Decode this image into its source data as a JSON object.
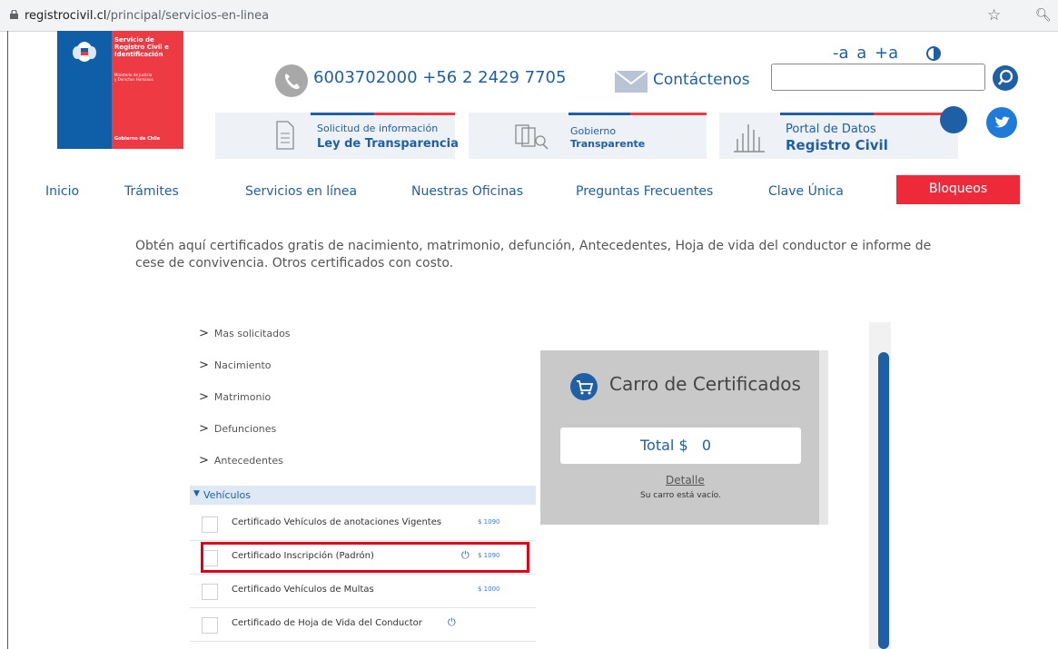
{
  "browser": {
    "url_host": "registrocivil.cl",
    "url_path": "/principal/servicios-en-linea"
  },
  "logo": {
    "line1": "Servicio de",
    "line2": "Registro Civil e",
    "line3": "Identificación",
    "sub1": "Ministerio de Justicia",
    "sub2": "y Derechos Humanos",
    "bottom": "Gobierno de Chile"
  },
  "header": {
    "phone": "6003702000 +56 2 2429 7705",
    "contact": "Contáctenos",
    "font_small": "-a",
    "font_normal": "a",
    "font_large": "+a",
    "search_value": ""
  },
  "info_boxes": [
    {
      "small": "Solicitud de información",
      "big": "Ley de Transparencia"
    },
    {
      "small": "Gobierno",
      "big": "Transparente"
    },
    {
      "small": "Portal de Datos",
      "big": "Registro Civil"
    }
  ],
  "nav": {
    "items": [
      "Inicio",
      "Trámites",
      "Servicios en línea",
      "Nuestras Oficinas",
      "Preguntas Frecuentes",
      "Clave Única"
    ],
    "highlight": "Bloqueos"
  },
  "intro": "Obtén aquí certificados gratis de nacimiento, matrimonio, defunción, Antecedentes, Hoja de vida del conductor e informe de cese de convivencia. Otros certificados con costo.",
  "categories": [
    "Mas solicitados",
    "Nacimiento",
    "Matrimonio",
    "Defunciones",
    "Antecedentes"
  ],
  "open_category": "Vehículos",
  "certificates": [
    {
      "name": "Certificado Vehículos de anotaciones Vigentes",
      "price": "$ 1090",
      "power": false
    },
    {
      "name": "Certificado Inscripción (Padrón)",
      "price": "$ 1090",
      "power": true
    },
    {
      "name": "Certificado Vehículos de Multas",
      "price": "$ 1000",
      "power": false
    },
    {
      "name": "Certificado de Hoja de Vida del Conductor",
      "price": "",
      "power": true
    }
  ],
  "cart": {
    "title": "Carro de Certificados",
    "total_label": "Total $",
    "total_value": "0",
    "detail": "Detalle",
    "empty": "Su carro está vacío."
  },
  "colors": {
    "brand_blue": "#1f5fa6",
    "brand_red": "#ee3a43",
    "highlight_border": "#e0001a"
  }
}
